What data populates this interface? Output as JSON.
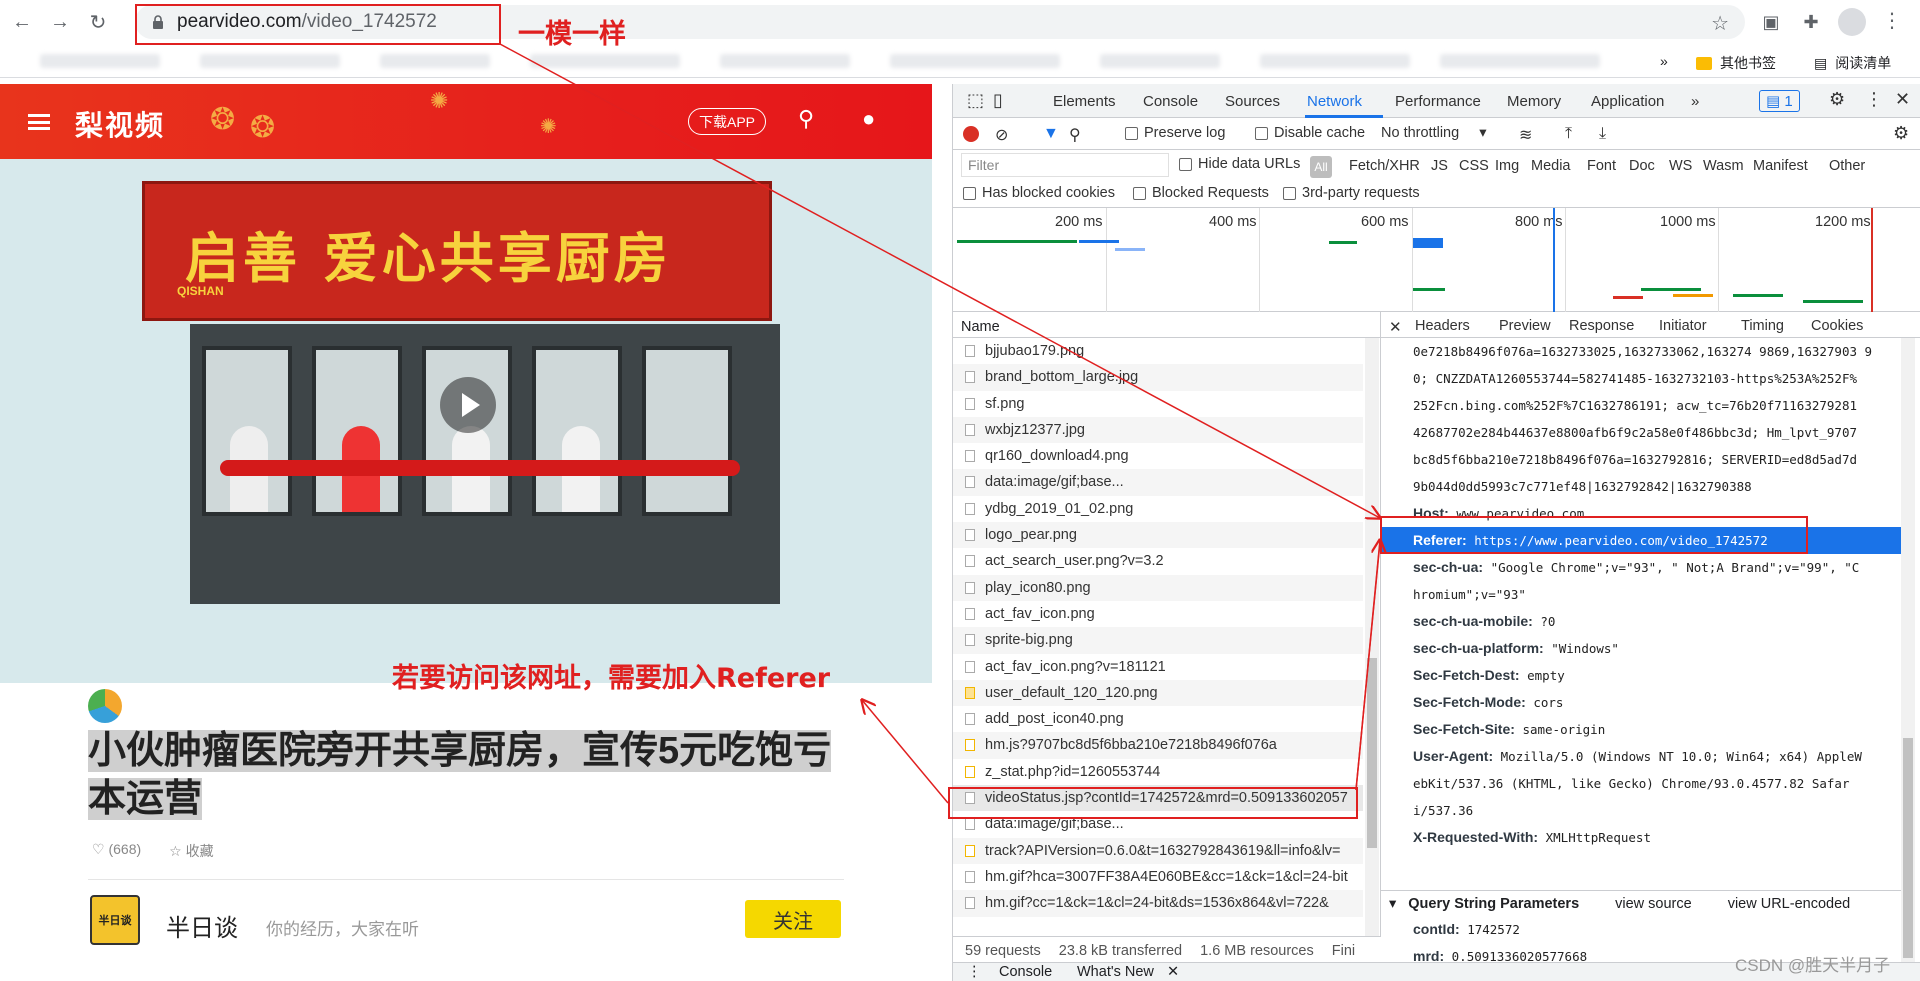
{
  "browser": {
    "url_host": "pearvideo.com",
    "url_path": "/video_1742572",
    "bookmarks": [
      {
        "label": "其他书签"
      },
      {
        "label": "阅读清单"
      }
    ]
  },
  "site": {
    "logo": "梨视频",
    "download_button": "下载APP",
    "sign_text": "启善 爱心共享厨房",
    "sign_sub": "QISHAN",
    "title": "小伙肿瘤医院旁开共享厨房，宣传5元吃饱亏本运营",
    "likes": "(668)",
    "favorite": "收藏",
    "author": {
      "avatar_text": "半日谈",
      "name": "半日谈",
      "desc": "你的经历，大家在听",
      "follow": "关注"
    }
  },
  "devtools": {
    "tabs": [
      "Elements",
      "Console",
      "Sources",
      "Network",
      "Performance",
      "Memory",
      "Application"
    ],
    "active_tab": "Network",
    "issues_count": "1",
    "toolbar": {
      "preserve_log": "Preserve log",
      "disable_cache": "Disable cache",
      "throttling": "No throttling"
    },
    "filter": {
      "placeholder": "Filter",
      "hide_data_urls": "Hide data URLs",
      "all": "All",
      "types": [
        "Fetch/XHR",
        "JS",
        "CSS",
        "Img",
        "Media",
        "Font",
        "Doc",
        "WS",
        "Wasm",
        "Manifest",
        "Other"
      ],
      "has_blocked_cookies": "Has blocked cookies",
      "blocked_requests": "Blocked Requests",
      "third_party": "3rd-party requests"
    },
    "timeline_labels": [
      "200 ms",
      "400 ms",
      "600 ms",
      "800 ms",
      "1000 ms",
      "1200 ms"
    ],
    "list_header": "Name",
    "requests": [
      "bjjubao179.png",
      "brand_bottom_large.jpg",
      "sf.png",
      "wxbjz12377.jpg",
      "qr160_download4.png",
      "data:image/gif;base...",
      "ydbg_2019_01_02.png",
      "logo_pear.png",
      "act_search_user.png?v=3.2",
      "play_icon80.png",
      "act_fav_icon.png",
      "sprite-big.png",
      "act_fav_icon.png?v=181121",
      "user_default_120_120.png",
      "add_post_icon40.png",
      "hm.js?9707bc8d5f6bba210e7218b8496f076a",
      "z_stat.php?id=1260553744",
      "videoStatus.jsp?contId=1742572&mrd=0.509133602057",
      "data:image/gif;base...",
      "track?APIVersion=0.6.0&t=1632792843619&ll=info&lv=",
      "hm.gif?hca=3007FF38A4E060BE&cc=1&ck=1&cl=24-bit",
      "hm.gif?cc=1&ck=1&cl=24-bit&ds=1536x864&vl=722&"
    ],
    "status": {
      "requests": "59 requests",
      "transferred": "23.8 kB transferred",
      "resources": "1.6 MB resources",
      "finish": "Fini"
    },
    "detail_tabs": [
      "Headers",
      "Preview",
      "Response",
      "Initiator",
      "Timing",
      "Cookies"
    ],
    "header_lines": [
      {
        "key": "",
        "value": "0e7218b8496f076a=1632733025,1632733062,163274 9869,16327903 9"
      },
      {
        "key": "",
        "value": "0; CNZZDATA1260553744=582741485-1632732103-https%253A%252F%"
      },
      {
        "key": "",
        "value": "252Fcn.bing.com%252F%7C1632786191; acw_tc=76b20f71163279281"
      },
      {
        "key": "",
        "value": "42687702e284b44637e8800afb6f9c2a58e0f486bbc3d; Hm_lpvt_9707"
      },
      {
        "key": "",
        "value": "bc8d5f6bba210e7218b8496f076a=1632792816; SERVERID=ed8d5ad7d"
      },
      {
        "key": "",
        "value": "9b044d0dd5993c7c771ef48|1632792842|1632790388"
      },
      {
        "key": "Host:",
        "value": "www.pearvideo.com"
      },
      {
        "key": "Referer:",
        "value": "https://www.pearvideo.com/video_1742572",
        "selected": true
      },
      {
        "key": "sec-ch-ua:",
        "value": "\"Google Chrome\";v=\"93\", \" Not;A Brand\";v=\"99\", \"C"
      },
      {
        "key": "",
        "value": "hromium\";v=\"93\""
      },
      {
        "key": "sec-ch-ua-mobile:",
        "value": "?0"
      },
      {
        "key": "sec-ch-ua-platform:",
        "value": "\"Windows\""
      },
      {
        "key": "Sec-Fetch-Dest:",
        "value": "empty"
      },
      {
        "key": "Sec-Fetch-Mode:",
        "value": "cors"
      },
      {
        "key": "Sec-Fetch-Site:",
        "value": "same-origin"
      },
      {
        "key": "User-Agent:",
        "value": "Mozilla/5.0 (Windows NT 10.0; Win64; x64) AppleW"
      },
      {
        "key": "",
        "value": "ebKit/537.36 (KHTML, like Gecko) Chrome/93.0.4577.82 Safar"
      },
      {
        "key": "",
        "value": "i/537.36"
      },
      {
        "key": "X-Requested-With:",
        "value": "XMLHttpRequest"
      }
    ],
    "query": {
      "title": "Query String Parameters",
      "view_source": "view source",
      "view_url_encoded": "view URL-encoded",
      "params": [
        {
          "key": "contId:",
          "value": "1742572"
        },
        {
          "key": "mrd:",
          "value": "0.5091336020577668"
        }
      ]
    },
    "drawer": {
      "console": "Console",
      "whats_new": "What's New"
    }
  },
  "annotations": {
    "same": "一模一样",
    "need_referer": "若要访问该网址，需要加入Referer"
  },
  "watermark": "CSDN @胜天半月子"
}
